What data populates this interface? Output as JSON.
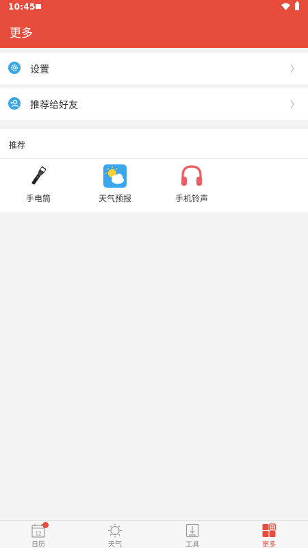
{
  "status_bar": {
    "time": "10:45"
  },
  "header": {
    "title": "更多"
  },
  "menu": {
    "settings": {
      "label": "设置",
      "chevron": "〉"
    },
    "share": {
      "label": "推荐给好友",
      "chevron": "〉"
    }
  },
  "recommend": {
    "title": "推荐",
    "items": [
      {
        "label": "手电筒",
        "icon": "flashlight-icon"
      },
      {
        "label": "天气预报",
        "icon": "weather-icon"
      },
      {
        "label": "手机铃声",
        "icon": "headphones-icon"
      }
    ]
  },
  "bottom_nav": {
    "items": [
      {
        "label": "日历",
        "icon": "calendar-icon",
        "date_number": "12"
      },
      {
        "label": "天气",
        "icon": "sun-icon"
      },
      {
        "label": "工具",
        "icon": "tools-icon"
      },
      {
        "label": "更多",
        "icon": "more-grid-icon",
        "active": true
      }
    ]
  },
  "colors": {
    "accent": "#e84c3d",
    "icon_blue": "#3aa7e6",
    "background": "#f3f3f3"
  }
}
